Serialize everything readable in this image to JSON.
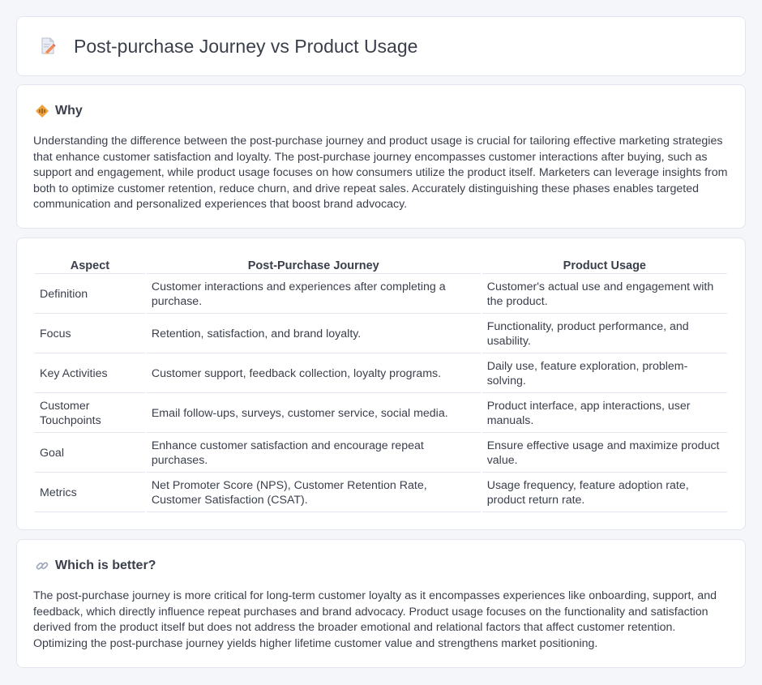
{
  "header": {
    "title": "Post-purchase Journey vs Product Usage",
    "icon": "document-edit-icon"
  },
  "why": {
    "title": "Why",
    "icon": "diamond-sign-icon",
    "text": "Understanding the difference between the post-purchase journey and product usage is crucial for tailoring effective marketing strategies that enhance customer satisfaction and loyalty. The post-purchase journey encompasses customer interactions after buying, such as support and engagement, while product usage focuses on how consumers utilize the product itself. Marketers can leverage insights from both to optimize customer retention, reduce churn, and drive repeat sales. Accurately distinguishing these phases enables targeted communication and personalized experiences that boost brand advocacy."
  },
  "table": {
    "headers": [
      "Aspect",
      "Post-Purchase Journey",
      "Product Usage"
    ],
    "rows": [
      [
        "Definition",
        "Customer interactions and experiences after completing a purchase.",
        "Customer's actual use and engagement with the product."
      ],
      [
        "Focus",
        "Retention, satisfaction, and brand loyalty.",
        "Functionality, product performance, and usability."
      ],
      [
        "Key Activities",
        "Customer support, feedback collection, loyalty programs.",
        "Daily use, feature exploration, problem-solving."
      ],
      [
        "Customer Touchpoints",
        "Email follow-ups, surveys, customer service, social media.",
        "Product interface, app interactions, user manuals."
      ],
      [
        "Goal",
        "Enhance customer satisfaction and encourage repeat purchases.",
        "Ensure effective usage and maximize product value."
      ],
      [
        "Metrics",
        "Net Promoter Score (NPS), Customer Retention Rate, Customer Satisfaction (CSAT).",
        "Usage frequency, feature adoption rate, product return rate."
      ]
    ]
  },
  "better": {
    "title": "Which is better?",
    "icon": "link-icon",
    "text": "The post-purchase journey is more critical for long-term customer loyalty as it encompasses experiences like onboarding, support, and feedback, which directly influence repeat purchases and brand advocacy. Product usage focuses on the functionality and satisfaction derived from the product itself but does not address the broader emotional and relational factors that affect customer retention. Optimizing the post-purchase journey yields higher lifetime customer value and strengthens market positioning."
  },
  "colors": {
    "background": "#f5f6fa",
    "card": "#ffffff",
    "border": "#e3e6ee",
    "text": "#3a3f4b",
    "accent_orange": "#f0a23a"
  }
}
